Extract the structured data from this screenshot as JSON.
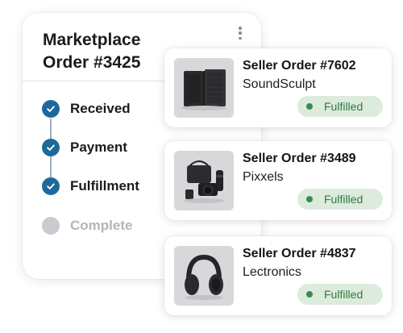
{
  "marketplace": {
    "title": "Marketplace Order #3425",
    "menu_icon": "kebab-menu-icon",
    "steps": [
      {
        "label": "Received",
        "status": "done",
        "icon": "check-icon"
      },
      {
        "label": "Payment",
        "status": "done",
        "icon": "check-icon"
      },
      {
        "label": "Fulfillment",
        "status": "done",
        "icon": "check-icon"
      },
      {
        "label": "Complete",
        "status": "pending",
        "icon": "pending-dot-icon"
      }
    ]
  },
  "seller_orders": [
    {
      "title": "Seller Order #7602",
      "seller": "SoundSculpt",
      "status": "Fulfilled",
      "image": "speakers-image"
    },
    {
      "title": "Seller Order #3489",
      "seller": "Pixxels",
      "status": "Fulfilled",
      "image": "camera-kit-image"
    },
    {
      "title": "Seller Order #4837",
      "seller": "Lectronics",
      "status": "Fulfilled",
      "image": "headphones-image"
    }
  ],
  "colors": {
    "step_done": "#1d6a9a",
    "step_pending": "#c9cbd1",
    "badge_bg": "#dcebdc",
    "badge_text": "#2f7a43"
  }
}
